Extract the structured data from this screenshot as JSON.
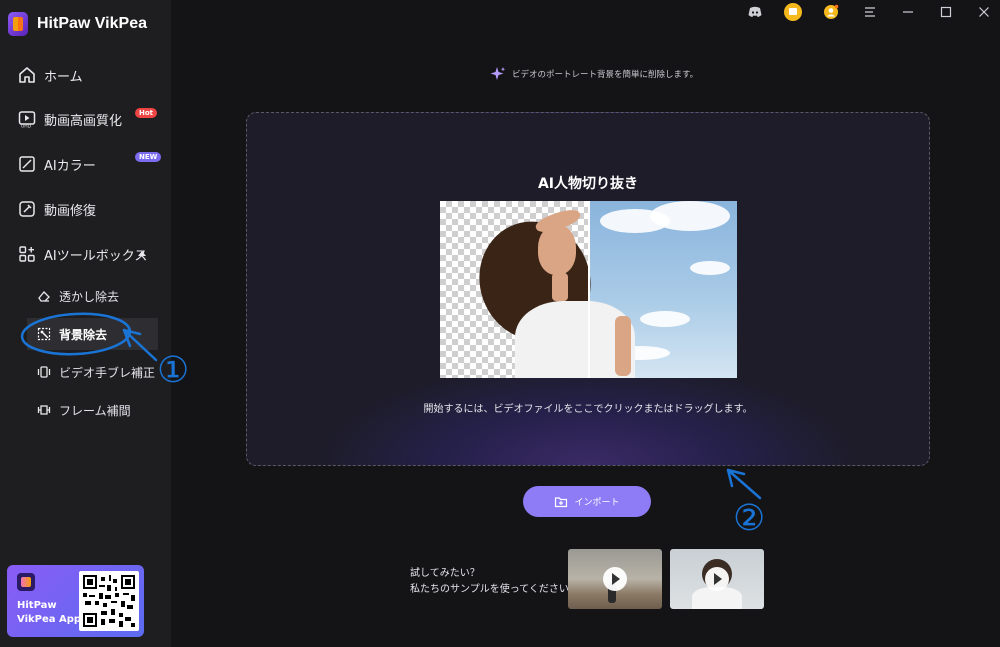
{
  "app": {
    "name": "HitPaw VikPea"
  },
  "sidebar": {
    "items": [
      {
        "label": "ホーム",
        "icon": "home-icon"
      },
      {
        "label": "動画高画質化",
        "icon": "uhd-video-icon",
        "badge": "Hot"
      },
      {
        "label": "AIカラー",
        "icon": "color-icon",
        "badge": "NEW"
      },
      {
        "label": "動画修復",
        "icon": "repair-icon"
      },
      {
        "label": "AIツールボックス",
        "icon": "toolbox-icon"
      }
    ],
    "subitems": [
      {
        "label": "透かし除去",
        "icon": "eraser-icon"
      },
      {
        "label": "背景除去",
        "icon": "background-remove-icon",
        "active": true
      },
      {
        "label": "ビデオ手ブレ補正",
        "icon": "stabilize-icon"
      },
      {
        "label": "フレーム補間",
        "icon": "frame-interpolation-icon"
      }
    ],
    "promo": {
      "line1": "HitPaw",
      "line2": "VikPea App"
    }
  },
  "titlebar": {
    "icons": [
      "discord-icon",
      "cart-icon",
      "account-icon",
      "menu-icon",
      "minimize-icon",
      "maximize-icon",
      "close-icon"
    ]
  },
  "main": {
    "hint": "ビデオのポートレート背景を簡単に削除します。",
    "title": "AI人物切り抜き",
    "instruction": "開始するには、ビデオファイルをここでクリックまたはドラッグします。",
    "import_label": "インポート",
    "sample_line1": "試してみたい？",
    "sample_line2": "私たちのサンプルを使ってください"
  },
  "annotations": {
    "mark1": "①",
    "mark2": "②"
  },
  "colors": {
    "accent": "#8d7cf5",
    "sidebar": "#1e1e20",
    "background": "#141416",
    "annotation": "#1a74d6"
  }
}
